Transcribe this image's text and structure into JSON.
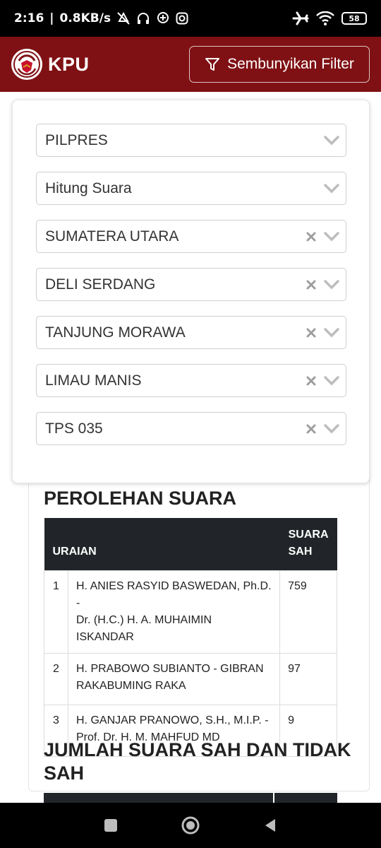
{
  "status_bar": {
    "time": "2:16",
    "speed": "0.8KB/s",
    "battery": "58",
    "icons": [
      "mute-icon",
      "headset-icon",
      "location-icon",
      "instagram-icon",
      "airplane-icon",
      "wifi-icon",
      "battery-icon"
    ]
  },
  "header": {
    "brand": "KPU",
    "filter_button": "Sembunyikan Filter",
    "colors": {
      "header_bg": "#7f1114",
      "text": "#ffffff"
    }
  },
  "filters": [
    {
      "value": "PILPRES",
      "clearable": false
    },
    {
      "value": "Hitung Suara",
      "clearable": false
    },
    {
      "value": "SUMATERA UTARA",
      "clearable": true
    },
    {
      "value": "DELI SERDANG",
      "clearable": true
    },
    {
      "value": "TANJUNG MORAWA",
      "clearable": true
    },
    {
      "value": "LIMAU MANIS",
      "clearable": true
    },
    {
      "value": "TPS 035",
      "clearable": true
    }
  ],
  "results": {
    "title": "PEROLEHAN SUARA",
    "columns": {
      "uraian": "URAIAN",
      "suara_sah_1": "SUARA",
      "suara_sah_2": "SAH"
    },
    "rows": [
      {
        "no": "1",
        "line1": "H. ANIES RASYID BASWEDAN, Ph.D. -",
        "line2": "Dr. (H.C.) H. A. MUHAIMIN ISKANDAR",
        "votes": "759"
      },
      {
        "no": "2",
        "line1": "H. PRABOWO SUBIANTO - GIBRAN",
        "line2": "RAKABUMING RAKA",
        "votes": "97"
      },
      {
        "no": "3",
        "line1": "H. GANJAR PRANOWO, S.H., M.I.P. -",
        "line2": "Prof. Dr. H. M. MAHFUD MD",
        "votes": "9"
      }
    ]
  },
  "totals": {
    "title_line1": "JUMLAH SUARA SAH DAN TIDAK",
    "title_line2": "SAH"
  },
  "navbar": {
    "buttons": [
      "recents-button",
      "home-button",
      "back-button"
    ]
  }
}
